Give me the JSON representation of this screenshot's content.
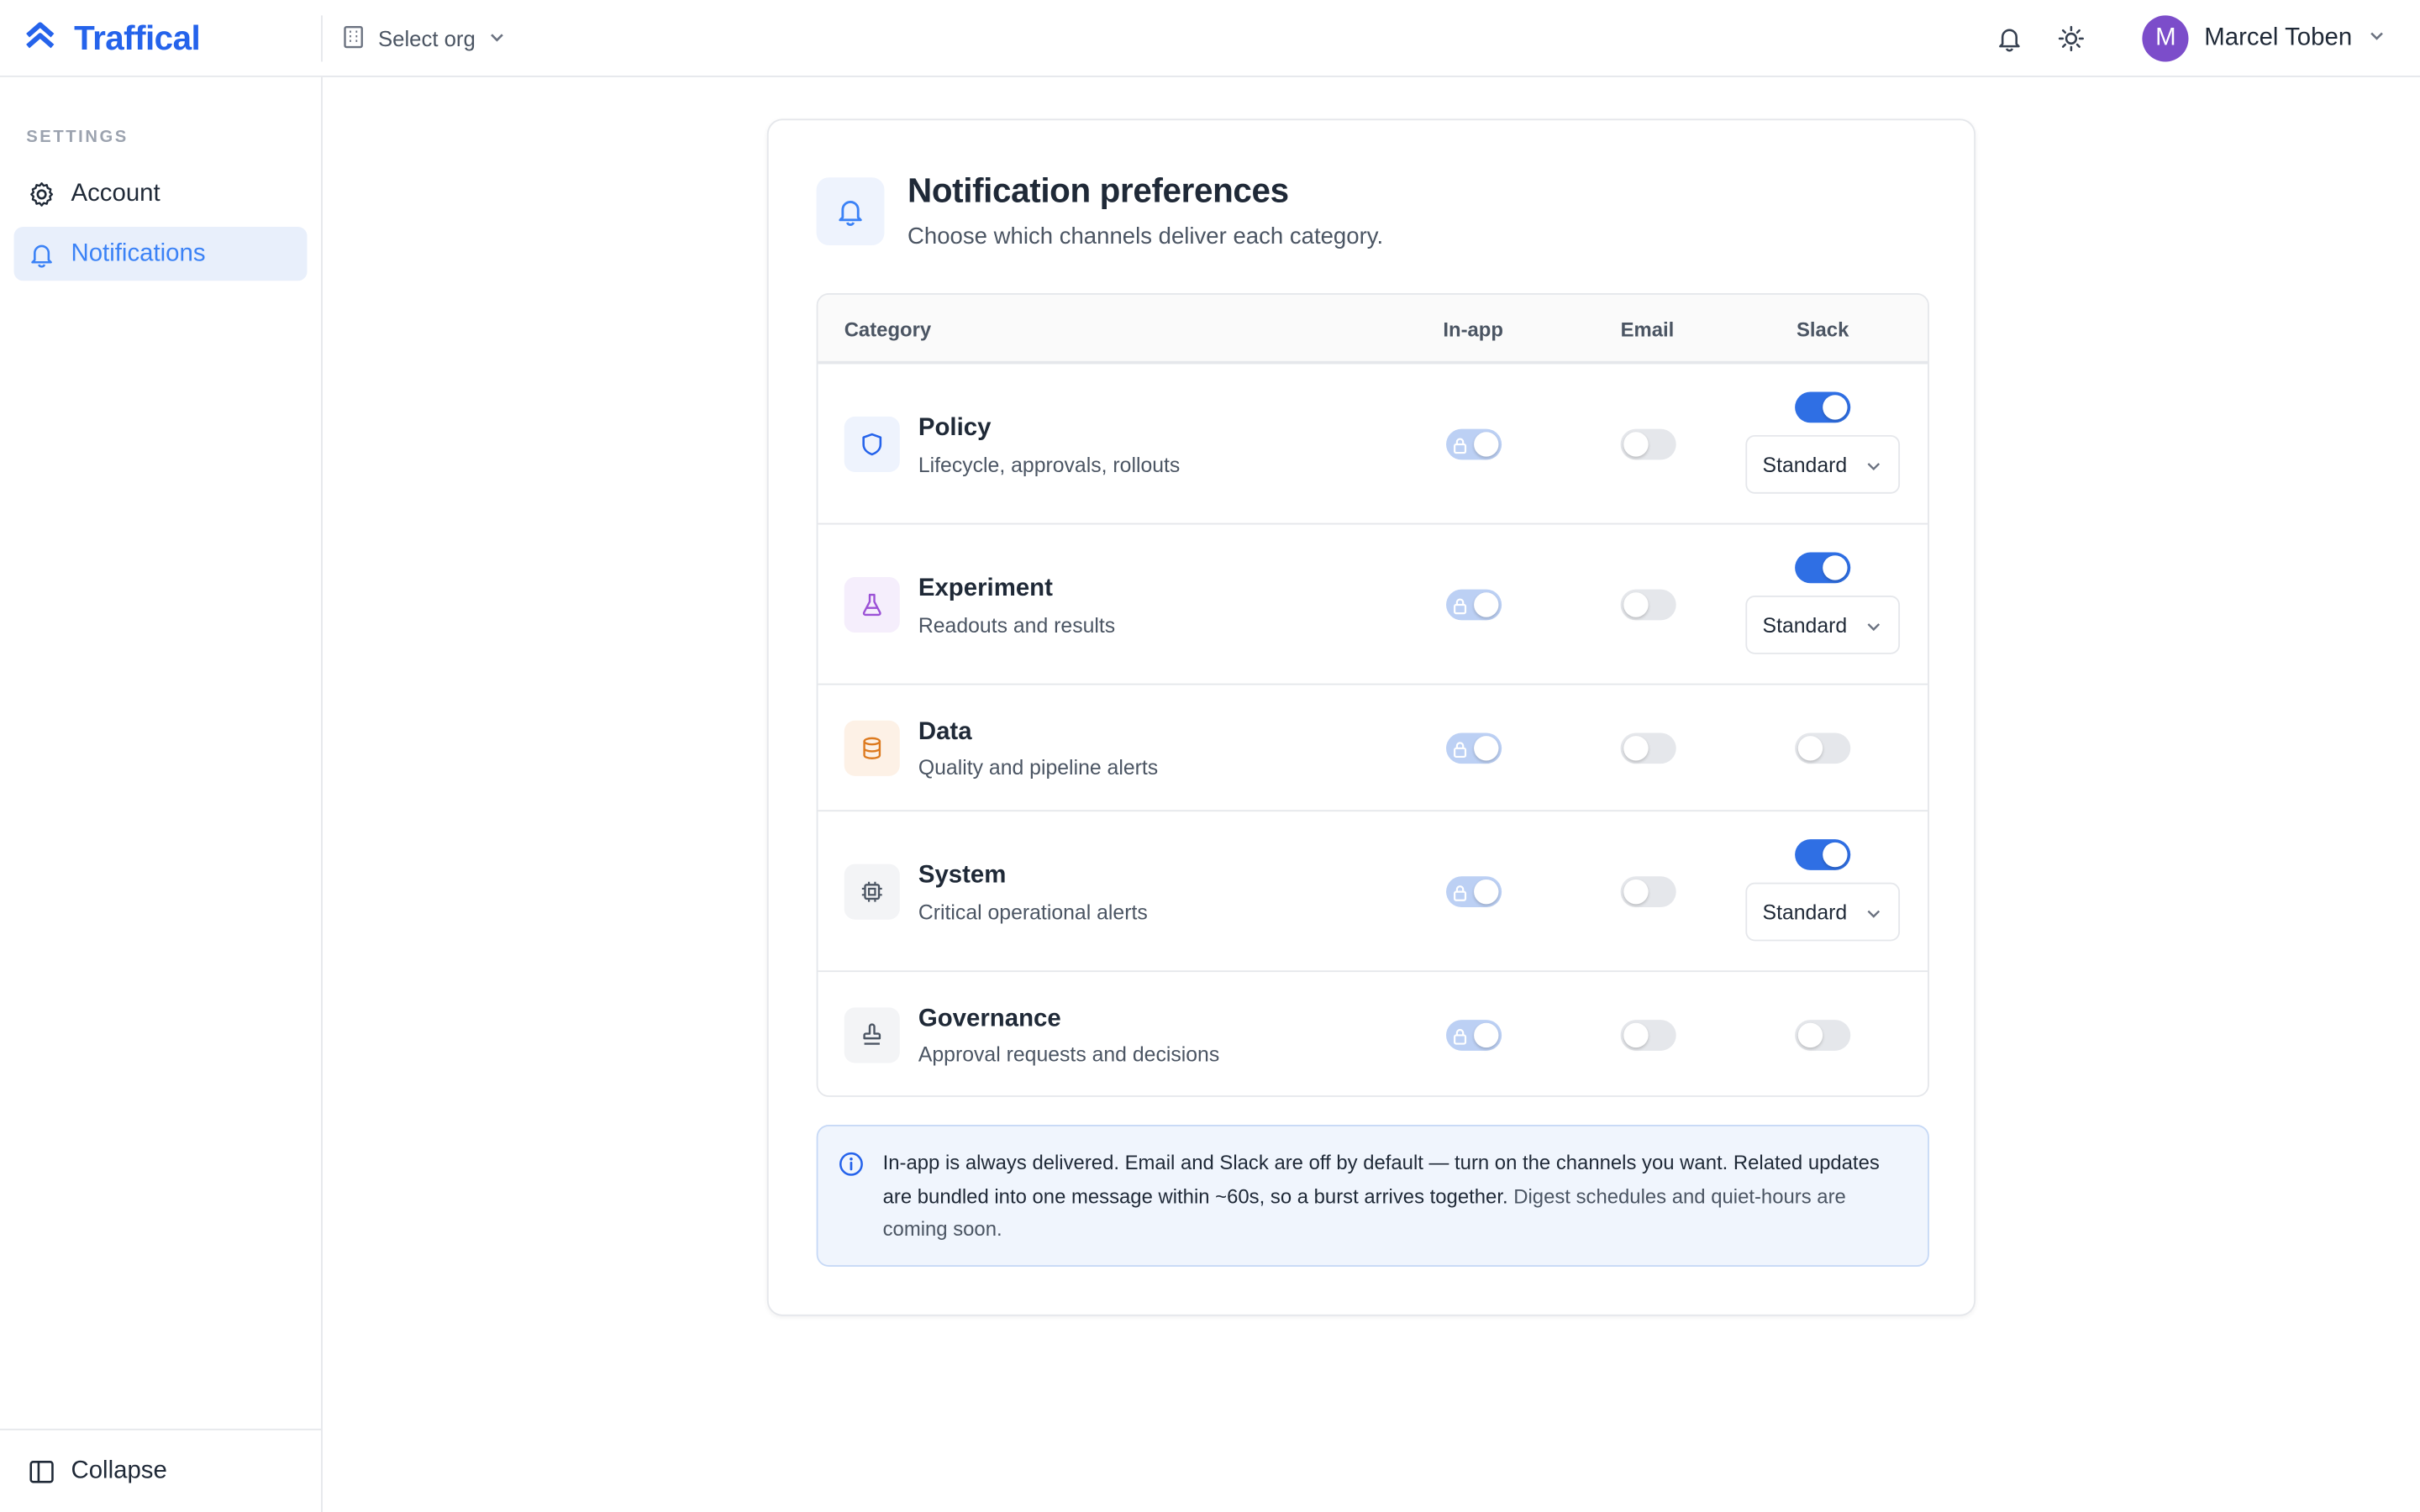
{
  "app": {
    "name": "Traffical"
  },
  "org_select": {
    "label": "Select org"
  },
  "user": {
    "initial": "M",
    "name": "Marcel Toben"
  },
  "sidebar": {
    "section": "SETTINGS",
    "items": [
      {
        "label": "Account",
        "icon": "gear-icon",
        "active": false
      },
      {
        "label": "Notifications",
        "icon": "bell-icon",
        "active": true
      }
    ],
    "collapse_label": "Collapse"
  },
  "page": {
    "title": "Notification preferences",
    "subtitle": "Choose which channels deliver each category."
  },
  "table": {
    "columns": [
      "Category",
      "In-app",
      "Email",
      "Slack"
    ],
    "rows": [
      {
        "name": "Policy",
        "desc": "Lifecycle, approvals, rollouts",
        "icon": "shield-icon",
        "in_app": "locked-on",
        "email": false,
        "slack": true,
        "slack_mode": "Standard"
      },
      {
        "name": "Experiment",
        "desc": "Readouts and results",
        "icon": "flask-icon",
        "in_app": "locked-on",
        "email": false,
        "slack": true,
        "slack_mode": "Standard"
      },
      {
        "name": "Data",
        "desc": "Quality and pipeline alerts",
        "icon": "database-icon",
        "in_app": "locked-on",
        "email": false,
        "slack": false
      },
      {
        "name": "System",
        "desc": "Critical operational alerts",
        "icon": "cpu-icon",
        "in_app": "locked-on",
        "email": false,
        "slack": true,
        "slack_mode": "Standard"
      },
      {
        "name": "Governance",
        "desc": "Approval requests and decisions",
        "icon": "stamp-icon",
        "in_app": "locked-on",
        "email": false,
        "slack": false
      }
    ]
  },
  "info_note": {
    "main": "In-app is always delivered. Email and Slack are off by default — turn on the channels you want. Related updates are bundled into one message within ~60s, so a burst arrives together.",
    "muted": "Digest schedules and quiet-hours are coming soon."
  },
  "colors": {
    "brand": "#2563eb",
    "toggle_on": "#2f6fe4",
    "toggle_locked": "#bcd0f4",
    "active_nav_bg": "#e8effb",
    "avatar": "#7c4dca"
  }
}
